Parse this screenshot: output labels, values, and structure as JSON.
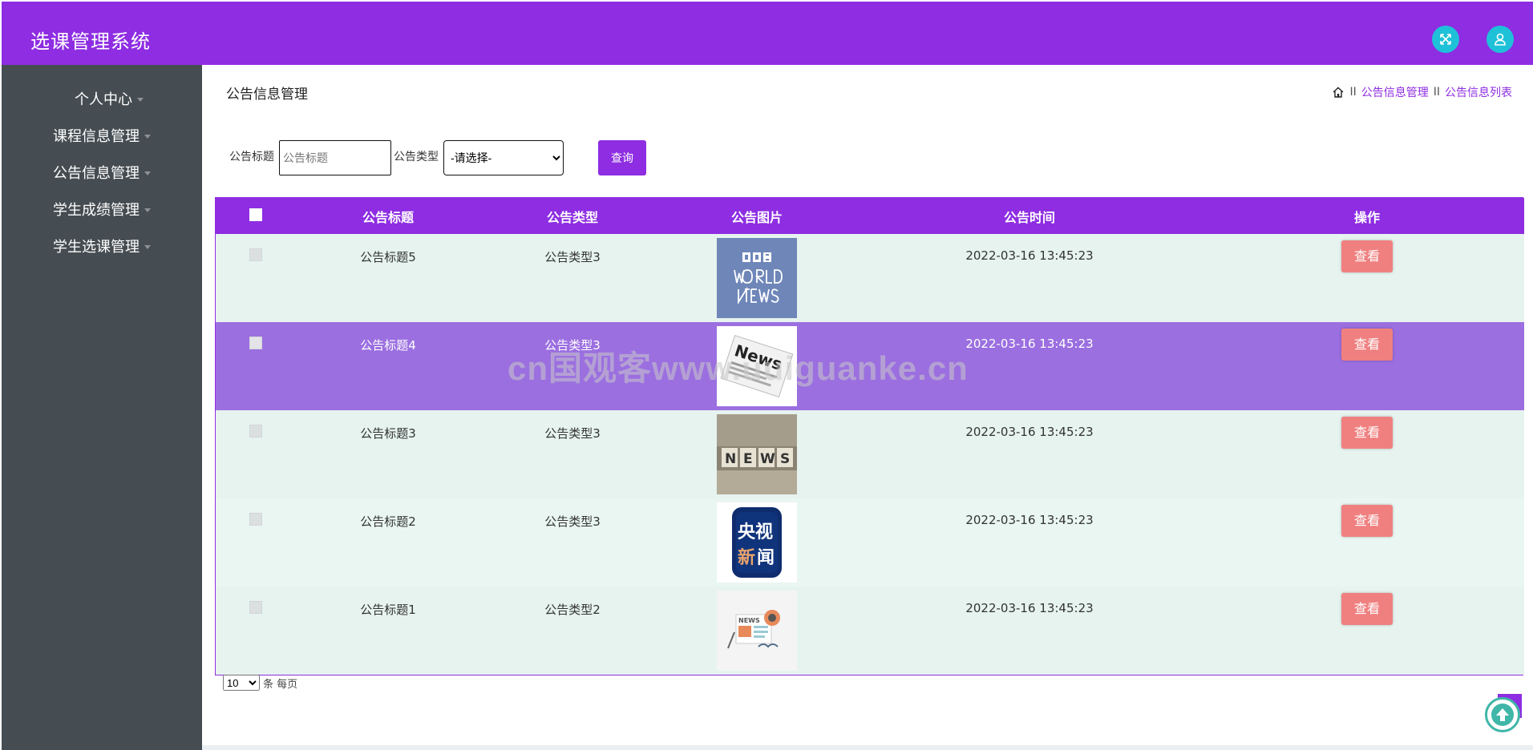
{
  "app": {
    "title": "选课管理系统"
  },
  "header": {
    "fullscreen_icon": "expand-icon",
    "user_icon": "user-icon",
    "accent": "#8e2de2",
    "icon_bg": "#1fc1d8"
  },
  "sidebar": {
    "items": [
      {
        "label": "个人中心"
      },
      {
        "label": "课程信息管理"
      },
      {
        "label": "公告信息管理"
      },
      {
        "label": "学生成绩管理"
      },
      {
        "label": "学生选课管理"
      }
    ]
  },
  "page": {
    "title": "公告信息管理",
    "breadcrumb": {
      "sep": "II",
      "level1": "公告信息管理",
      "level2": "公告信息列表"
    }
  },
  "search": {
    "title_label": "公告标题",
    "title_placeholder": "公告标题",
    "type_label": "公告类型",
    "type_selected": "-请选择-",
    "query_button": "查询"
  },
  "table": {
    "headers": {
      "title": "公告标题",
      "type": "公告类型",
      "image": "公告图片",
      "time": "公告时间",
      "action": "操作"
    },
    "rows": [
      {
        "title": "公告标题5",
        "type": "公告类型3",
        "image": "bbc-world-news",
        "time": "2022-03-16 13:45:23",
        "action": "查看"
      },
      {
        "title": "公告标题4",
        "type": "公告类型3",
        "image": "news-paper",
        "time": "2022-03-16 13:45:23",
        "action": "查看"
      },
      {
        "title": "公告标题3",
        "type": "公告类型3",
        "image": "news-blocks",
        "time": "2022-03-16 13:45:23",
        "action": "查看"
      },
      {
        "title": "公告标题2",
        "type": "公告类型3",
        "image": "cctv-news",
        "time": "2022-03-16 13:45:23",
        "action": "查看"
      },
      {
        "title": "公告标题1",
        "type": "公告类型2",
        "image": "news-illustration",
        "time": "2022-03-16 13:45:23",
        "action": "查看"
      }
    ]
  },
  "pager": {
    "page_size": "10",
    "suffix": "条 每页"
  },
  "watermark": "cn国观客www.uuiguanke.cn"
}
